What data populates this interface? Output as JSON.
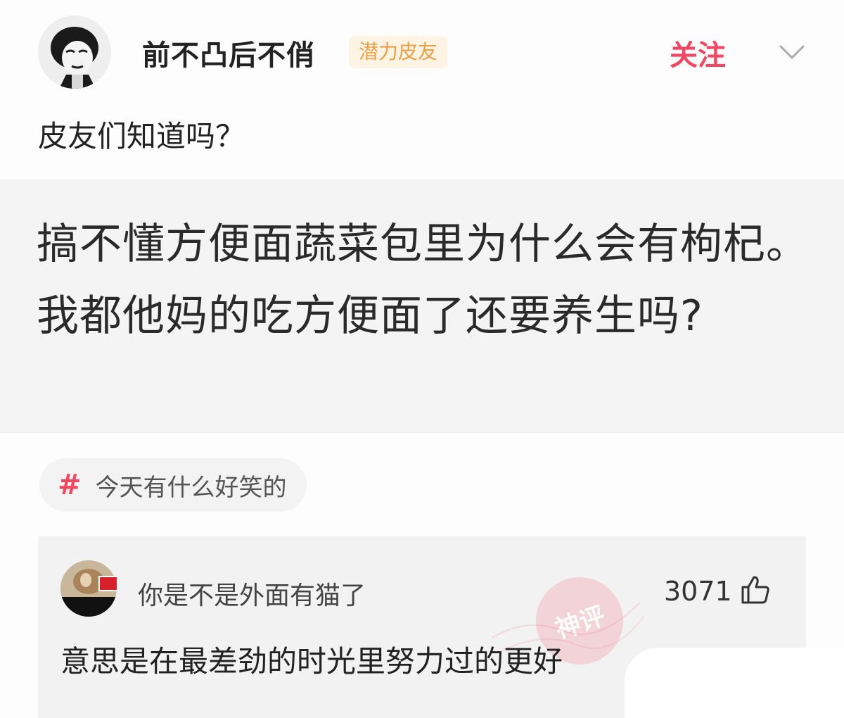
{
  "post": {
    "username": "前不凸后不俏",
    "badge": "潜力皮友",
    "follow_label": "关注",
    "text": "皮友们知道吗？",
    "quote": "搞不懂方便面蔬菜包里为什么会有枸杞。我都他妈的吃方便面了还要养生吗?",
    "topic_symbol": "#",
    "topic": "今天有什么好笑的"
  },
  "comment": {
    "username": "你是不是外面有猫了",
    "likes": "3071",
    "text": "意思是在最差劲的时光里努力过的更好"
  },
  "watermark": {
    "text": "神评"
  },
  "icons": {
    "avatar": "meme-face-avatar",
    "chevron": "chevron-down-icon",
    "like": "thumbs-up-icon",
    "flag": "flag-icon"
  },
  "colors": {
    "accent": "#ef4862",
    "badge_bg": "#fff3e3",
    "badge_text": "#e9a149",
    "quote_bg": "#f4f4f4",
    "comment_bg": "#f2f2f2"
  }
}
